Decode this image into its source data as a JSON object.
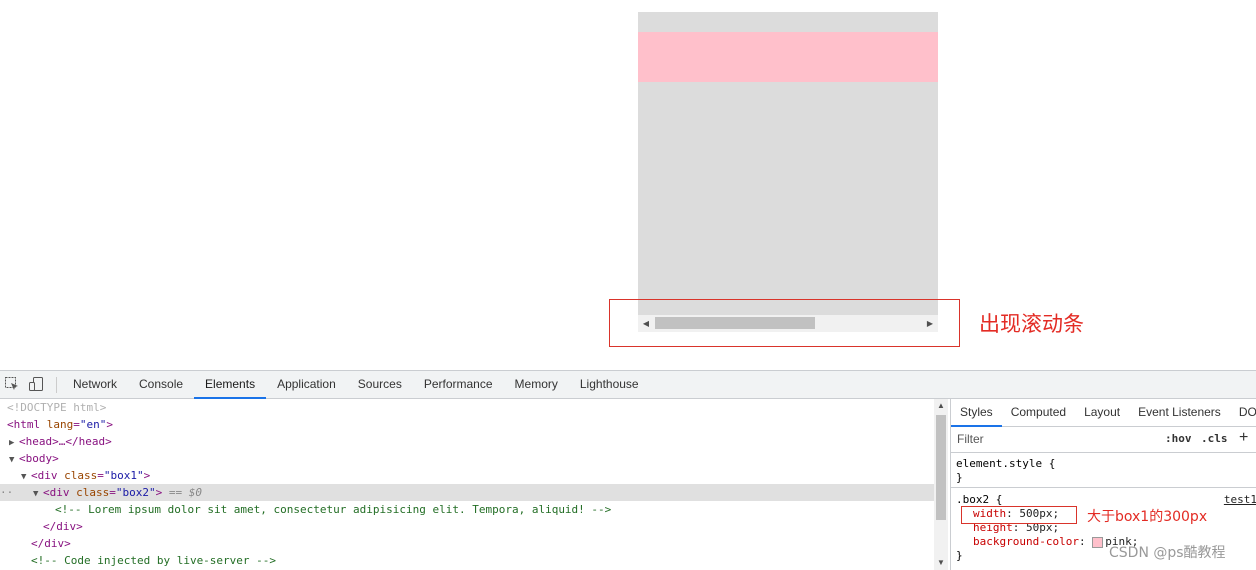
{
  "colors": {
    "box1": "#dcdcdc",
    "box2": "#ffc0cb",
    "annotation": "#e32b24",
    "tab_accent": "#1a73e8"
  },
  "annotation": {
    "scrollbar_note": "出现滚动条",
    "width_note": "大于box1的300px"
  },
  "devtools": {
    "tabs": [
      "Network",
      "Console",
      "Elements",
      "Application",
      "Sources",
      "Performance",
      "Memory",
      "Lighthouse"
    ],
    "active_tab": "Elements",
    "dom": {
      "doctype": "<!DOCTYPE html>",
      "html_tag": "html",
      "lang_attr": "lang",
      "lang_val": "\"en\"",
      "head_text": "<head>…</head>",
      "body_tag": "body",
      "box1_tag": "div",
      "class_attr": "class",
      "box1_val": "\"box1\"",
      "box2_val": "\"box2\"",
      "selected_marker": "== $0",
      "comment": "<!-- Lorem ipsum dolor sit amet, consectetur adipisicing elit. Tempora, aliquid! -->",
      "div_close": "</div>",
      "injected_comment": "<!-- Code injected by live-server -->"
    },
    "styles": {
      "tabs": [
        "Styles",
        "Computed",
        "Layout",
        "Event Listeners",
        "DO"
      ],
      "active_tab": "Styles",
      "filter_placeholder": "Filter",
      "hov": ":hov",
      "cls": ".cls",
      "plus": "+",
      "element_style_selector": "element.style {",
      "close_brace": "}",
      "box2_selector": ".box2 {",
      "source": "test1",
      "width_prop": "width",
      "width_val": "500px;",
      "height_prop": "height",
      "height_val": "50px;",
      "bg_prop": "background-color",
      "bg_val": "pink;"
    }
  },
  "watermark": "CSDN @ps酷教程"
}
